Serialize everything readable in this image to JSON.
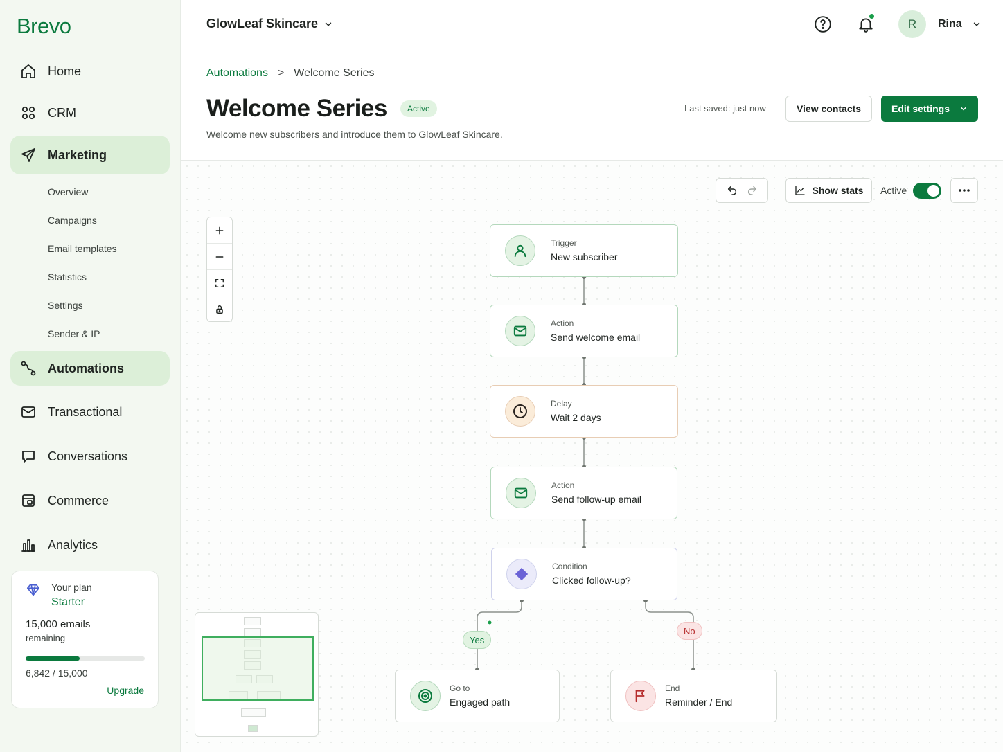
{
  "app": {
    "logo": "Brevo"
  },
  "sidebar": {
    "items": [
      {
        "label": "Home",
        "icon": "home-icon"
      },
      {
        "label": "CRM",
        "icon": "users-icon"
      },
      {
        "label": "Marketing",
        "icon": "send-icon",
        "active": true
      },
      {
        "label": "Automations",
        "icon": "workflow-icon",
        "active": true
      },
      {
        "label": "Transactional",
        "icon": "mail-icon"
      },
      {
        "label": "Conversations",
        "icon": "chat-icon"
      },
      {
        "label": "Commerce",
        "icon": "store-icon"
      },
      {
        "label": "Analytics",
        "icon": "bar-chart-icon"
      }
    ],
    "marketing_sub": [
      "Overview",
      "Campaigns",
      "Email templates",
      "Statistics",
      "Settings",
      "Sender & IP"
    ],
    "plan": {
      "label": "Your plan",
      "name": "Starter",
      "emails": "15,000 emails",
      "remaining_label": "remaining",
      "usage": "6,842 / 15,000",
      "usage_fraction": 0.456,
      "upgrade": "Upgrade"
    }
  },
  "topbar": {
    "company": "GlowLeaf Skincare",
    "avatar_initial": "R",
    "user": "Rina",
    "has_notification": true
  },
  "header": {
    "breadcrumb_parent": "Automations",
    "breadcrumb_separator": ">",
    "breadcrumb_current": "Welcome Series",
    "title": "Welcome Series",
    "status": "Active",
    "description": "Welcome new subscribers and introduce them to GlowLeaf Skincare.",
    "last_saved": "Last saved: just now",
    "view_contacts": "View contacts",
    "edit_settings": "Edit settings"
  },
  "canvas_toolbar": {
    "show_stats": "Show stats",
    "active_label": "Active",
    "active_on": true
  },
  "workflow": {
    "nodes": [
      {
        "type": "Trigger",
        "label": "New subscriber",
        "icon": "user-icon"
      },
      {
        "type": "Action",
        "label": "Send welcome email",
        "icon": "mail-icon"
      },
      {
        "type": "Delay",
        "label": "Wait 2 days",
        "icon": "clock-icon"
      },
      {
        "type": "Action",
        "label": "Send follow-up email",
        "icon": "mail-icon"
      },
      {
        "type": "Condition",
        "label": "Clicked follow-up?",
        "icon": "diamond-icon"
      },
      {
        "type": "Go to",
        "label": "Engaged path",
        "icon": "target-icon"
      },
      {
        "type": "End",
        "label": "Reminder / End",
        "icon": "flag-icon"
      }
    ],
    "branches": {
      "yes": "Yes",
      "no": "No"
    }
  },
  "colors": {
    "brand": "#0b7a3e",
    "sidebar_bg": "#f3f8f1",
    "active_nav": "#dcefd8",
    "no_branch": "#b52c2c"
  }
}
